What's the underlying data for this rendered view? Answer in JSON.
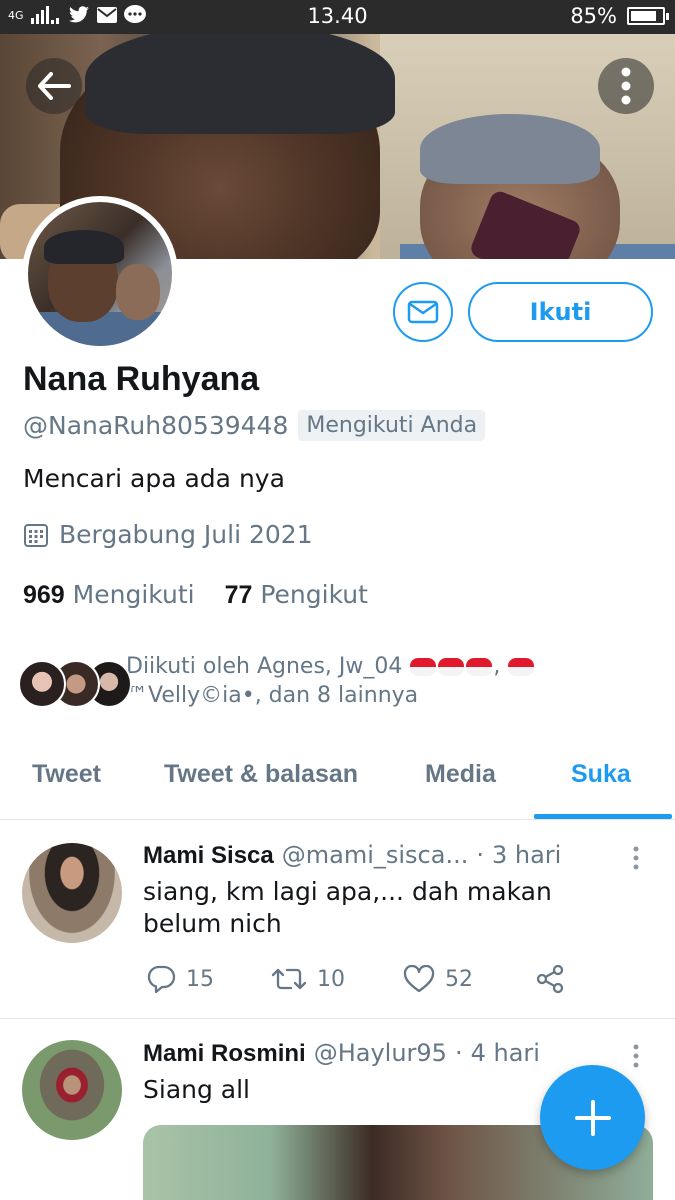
{
  "status_bar": {
    "network": "4G",
    "time": "13.40",
    "battery": "85%",
    "battery_level": 0.85
  },
  "profile": {
    "name": "Nana Ruhyana",
    "handle": "@NanaRuh80539448",
    "follows_you": "Mengikuti Anda",
    "bio": "Mencari apa ada nya",
    "joined": "Bergabung Juli 2021",
    "following_count": "969",
    "following_label": "Mengikuti",
    "followers_count": "77",
    "followers_label": "Pengikut",
    "followed_by_1": "Diikuti oleh Agnes, Jw_04",
    "followed_by_2": "™Velly©ia•, dan 8 lainnya",
    "follow_button": "Ikuti"
  },
  "tabs": [
    {
      "label": "Tweet"
    },
    {
      "label": "Tweet & balasan"
    },
    {
      "label": "Media"
    },
    {
      "label": "Suka",
      "active": true
    }
  ],
  "tweets": [
    {
      "display_name": "Mami Sisca",
      "username": "@mami_sisca...",
      "time": "3 hari",
      "text": "siang, km lagi apa,... dah makan belum nich",
      "replies": "15",
      "retweets": "10",
      "likes": "52"
    },
    {
      "display_name": "Mami Rosmini",
      "username": "@Haylur95",
      "time": "4 hari",
      "text": "Siang all"
    }
  ],
  "colors": {
    "accent": "#1d9bf0",
    "secondary_text": "#657786",
    "primary_text": "#14171a"
  },
  "icons": [
    "back-arrow-icon",
    "more-vertical-icon",
    "mail-icon",
    "calendar-icon",
    "reply-icon",
    "retweet-icon",
    "like-icon",
    "share-icon",
    "compose-plus-icon"
  ]
}
